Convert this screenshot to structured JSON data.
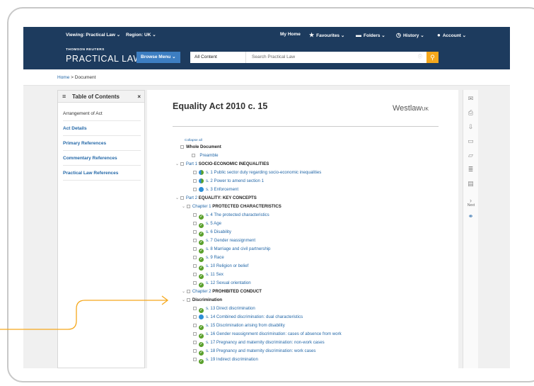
{
  "topbar": {
    "viewing": "Viewing: Practical Law",
    "region": "Region: UK",
    "my_home": "My Home",
    "favourites": "Favourites",
    "folders": "Folders",
    "history": "History",
    "account": "Account"
  },
  "brand": {
    "small": "THOMSON REUTERS",
    "big": "PRACTICAL LAW"
  },
  "search": {
    "browse_label": "Browse Menu",
    "scope_value": "All Content",
    "placeholder": "Search Practical Law"
  },
  "breadcrumb": {
    "home": "Home",
    "sep": " > ",
    "current": "Document"
  },
  "sidebar": {
    "title": "Table of Contents",
    "items": [
      "Arrangement of Act",
      "Act Details",
      "Primary References",
      "Commentary References",
      "Practical Law References"
    ]
  },
  "document": {
    "title": "Equality Act 2010 c. 15",
    "publisher": "Westlaw",
    "publisher_suffix": "UK",
    "collapse_all": "Collapse all",
    "whole_document": "Whole Document",
    "preamble": "Preamble",
    "part1_num": "Part 1",
    "part1_title": "SOCIO-ECONOMIC INEQUALITIES",
    "s1": "s. 1 Public sector duty regarding socio-economic inequalities",
    "s2": "s. 2 Power to amend section 1",
    "s3": "s. 3 Enforcement",
    "part2_num": "Part 2",
    "part2_title": "EQUALITY: KEY CONCEPTS",
    "ch1_num": "Chapter 1",
    "ch1_title": "PROTECTED CHARACTERISTICS",
    "ch1_sections": [
      "s. 4 The protected characteristics",
      "s. 5 Age",
      "s. 6 Disability",
      "s. 7 Gender reassignment",
      "s. 8 Marriage and civil partnership",
      "s. 9 Race",
      "s. 10 Religion or belief",
      "s. 11 Sex",
      "s. 12 Sexual orientation"
    ],
    "ch2_num": "Chapter 2",
    "ch2_title": "PROHIBITED CONDUCT",
    "discrimination": "Discrimination",
    "ch2_sections": [
      "s. 13 Direct discrimination",
      "s. 14 Combined discrimination: dual characteristics",
      "s. 15 Discrimination arising from disability",
      "s. 16 Gender reassignment discrimination: cases of absence from work",
      "s. 17 Pregnancy and maternity discrimination: non-work cases",
      "s. 18 Pregnancy and maternity discrimination: work cases",
      "s. 19 Indirect discrimination"
    ]
  },
  "toolbar": {
    "next_label": "Next"
  },
  "colors": {
    "navy": "#1d3b5e",
    "browse_blue": "#3d7ec2",
    "search_orange": "#f5a81c",
    "link_blue": "#2468a8",
    "callout_orange": "#f5a81c"
  }
}
